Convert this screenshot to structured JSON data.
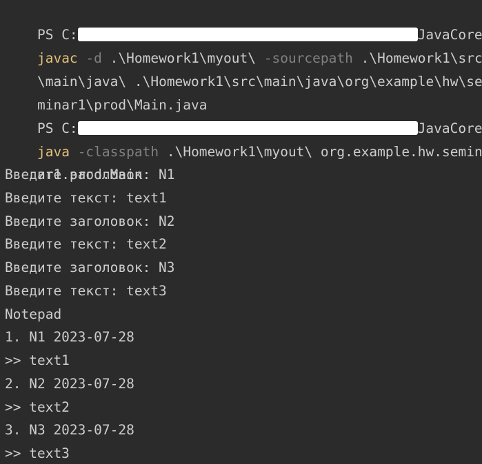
{
  "terminal": {
    "prompt1": {
      "prefix": "PS C:",
      "suffix": "JavaCore>"
    },
    "command1": {
      "cmd": "javac",
      "flag1": "-d",
      "arg1": ".\\Homework1\\myout\\",
      "flag2": "-sourcepath",
      "arg2a": ".\\Homework1\\src",
      "arg2b": "\\main\\java\\",
      "arg3a": ".\\Homework1\\src\\main\\java\\org\\example\\hw\\se",
      "arg3b": "minar1\\prod\\Main.java"
    },
    "prompt2": {
      "prefix": "PS C:",
      "suffix": "JavaCore>"
    },
    "command2": {
      "cmd": "java",
      "flag1": "-classpath",
      "arg1": ".\\Homework1\\myout\\",
      "arg2a": "org.example.hw.semin",
      "arg2b": "ar1.prod.Main"
    },
    "output": [
      "Введите заголовок: N1",
      "Введите текст: text1",
      "Введите заголовок: N2",
      "Введите текст: text2",
      "Введите заголовок: N3",
      "Введите текст: text3",
      "Notepad",
      "1. N1 2023-07-28",
      ">> text1",
      "2. N2 2023-07-28",
      ">> text2",
      "3. N3 2023-07-28",
      ">> text3"
    ]
  },
  "colors": {
    "background": "#2b2b2b",
    "text": "#cdcdcd",
    "command": "#e5c07b",
    "flag": "#808080",
    "redaction": "#ffffff"
  }
}
